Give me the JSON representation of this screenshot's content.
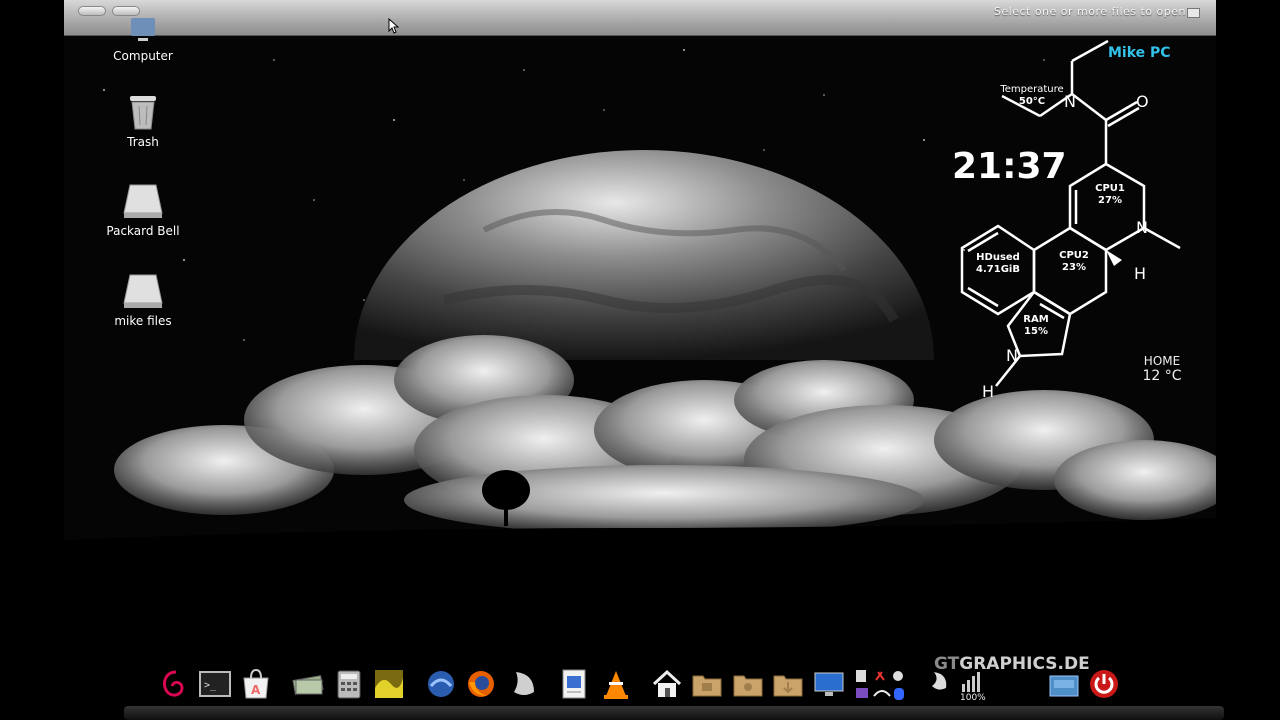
{
  "topbar": {
    "status_text": "Select one or more files to open"
  },
  "desktop_icons": [
    {
      "label": "Computer"
    },
    {
      "label": "Trash"
    },
    {
      "label": "Packard Bell"
    },
    {
      "label": "mike files"
    }
  ],
  "conky": {
    "pc_name": "Mike PC",
    "clock": "21:37",
    "temperature_label": "Temperature",
    "temperature_value": "50°C",
    "cpu1_label": "CPU1",
    "cpu1_value": "27%",
    "cpu2_label": "CPU2",
    "cpu2_value": "23%",
    "hd_label": "HDused",
    "hd_value": "4.71GiB",
    "ram_label": "RAM",
    "ram_value": "15%",
    "atom_o": "O",
    "atom_n1": "N",
    "atom_n2": "N",
    "atom_n3": "N",
    "atom_h1": "H",
    "atom_h2": "H",
    "weather_location": "HOME",
    "weather_temp": "12 °C",
    "accent_color": "#33c1e8"
  },
  "dock": {
    "battery_label": "100%",
    "watermark_gt": "GT",
    "watermark_rest": "GRAPHICS.DE",
    "icons": [
      "debian-swirl-icon",
      "terminal-icon",
      "software-center-icon",
      "money-icon",
      "calculator-icon",
      "image-viewer-icon",
      "thunderbird-icon",
      "firefox-icon",
      "moon-icon",
      "document-icon",
      "vlc-icon",
      "home-folder-icon",
      "folder-icon",
      "folder-icon",
      "folder-icon",
      "monitor-icon",
      "system-tray-icons",
      "power-icon"
    ]
  }
}
